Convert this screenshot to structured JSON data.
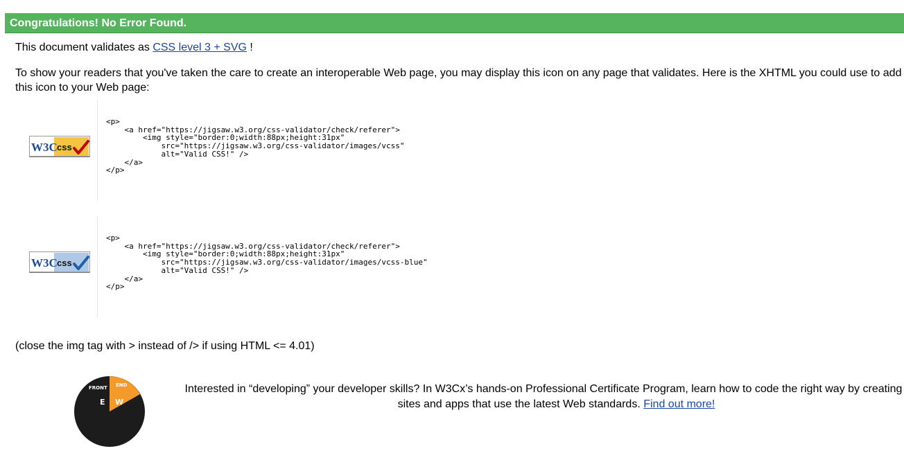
{
  "banner": {
    "title": "Congratulations! No Error Found."
  },
  "validation": {
    "prefix": "This document validates as",
    "level_link": "CSS level 3 + SVG",
    "suffix": "!"
  },
  "intro": "To show your readers that you've taken the care to create an interoperable Web page, you may display this icon on any page that validates. Here is the XHTML you could use to add this icon to your Web page:",
  "badges": [
    {
      "alt": "Valid CSS!",
      "logo_text": "W3C",
      "css_text": "css",
      "color": "#f5c441",
      "check_color": "#c00000",
      "code": "<p>\n    <a href=\"https://jigsaw.w3.org/css-validator/check/referer\">\n        <img style=\"border:0;width:88px;height:31px\"\n            src=\"https://jigsaw.w3.org/css-validator/images/vcss\"\n            alt=\"Valid CSS!\" />\n    </a>\n</p>"
    },
    {
      "alt": "Valid CSS!",
      "logo_text": "W3C",
      "css_text": "css",
      "color": "#aec8e6",
      "check_color": "#1f5fa8",
      "code": "<p>\n    <a href=\"https://jigsaw.w3.org/css-validator/check/referer\">\n        <img style=\"border:0;width:88px;height:31px\"\n            src=\"https://jigsaw.w3.org/css-validator/images/vcss-blue\"\n            alt=\"Valid CSS!\" />\n    </a>\n</p>"
    }
  ],
  "note": "(close the img tag with > instead of /> if using HTML <= 4.01)",
  "promo": {
    "logo_letters": [
      "FRONT",
      "END",
      "E",
      "W"
    ],
    "text": "Interested in “developing” your developer skills? In W3Cx’s hands-on Professional Certificate Program, learn how to code the right way by creating Web sites and apps that use the latest Web standards.",
    "link": "Find out more!"
  }
}
